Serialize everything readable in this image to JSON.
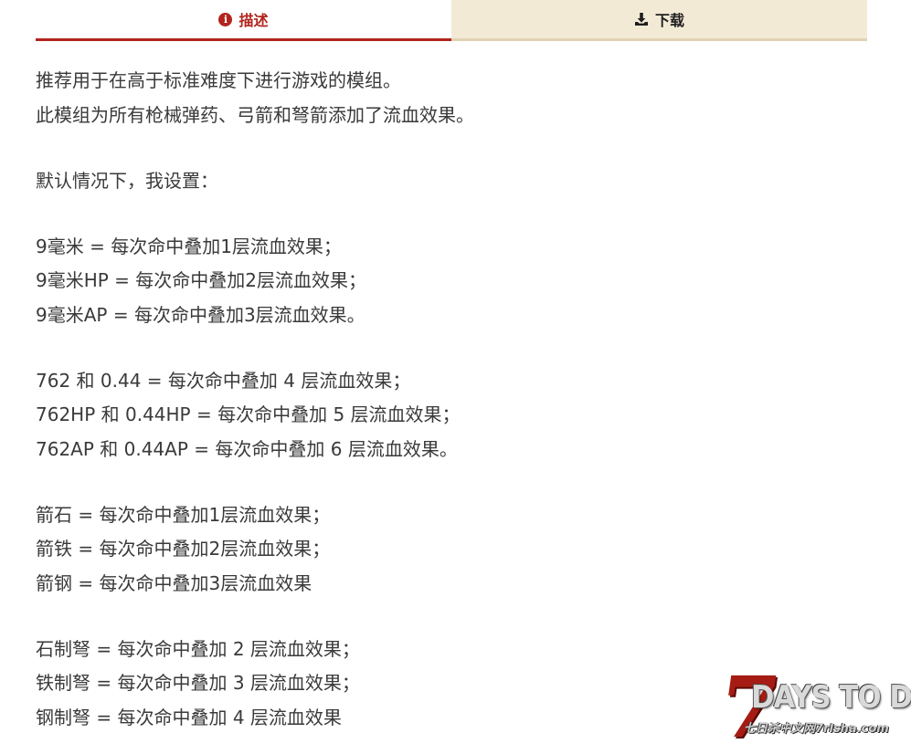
{
  "tabs": {
    "description": {
      "label": "描述",
      "icon": "info-icon"
    },
    "download": {
      "label": "下载",
      "icon": "download-icon"
    }
  },
  "colors": {
    "accent": "#b3241d",
    "tab_inactive_bg": "#f3ead6",
    "text": "#3a3a3a"
  },
  "content": {
    "intro": [
      "推荐用于在高于标准难度下进行游戏的模组。",
      "此模组为所有枪械弹药、弓箭和弩箭添加了流血效果。"
    ],
    "settings_heading": "默认情况下，我设置：",
    "groups": [
      [
        "9毫米 = 每次命中叠加1层流血效果；",
        "9毫米HP = 每次命中叠加2层流血效果；",
        "9毫米AP = 每次命中叠加3层流血效果。"
      ],
      [
        "762 和 0.44 = 每次命中叠加 4 层流血效果；",
        "762HP 和 0.44HP = 每次命中叠加 5 层流血效果；",
        "762AP 和 0.44AP = 每次命中叠加 6 层流血效果。"
      ],
      [
        "箭石 = 每次命中叠加1层流血效果；",
        "箭铁 = 每次命中叠加2层流血效果；",
        "箭钢 = 每次命中叠加3层流血效果"
      ],
      [
        "石制弩 = 每次命中叠加 2 层流血效果；",
        "铁制弩 = 每次命中叠加 3 层流血效果；",
        "钢制弩 = 每次命中叠加 4 层流血效果"
      ]
    ]
  },
  "logo": {
    "numeral": "7",
    "title": "DAYS TO DIE",
    "subtitle": "七日杀中文网7rlsha.com"
  }
}
